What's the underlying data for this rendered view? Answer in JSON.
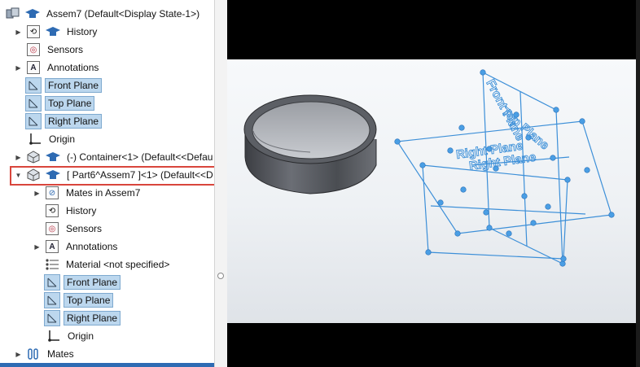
{
  "feature_tree": {
    "root": {
      "label": "Assem7  (Default<Display State-1>)"
    },
    "items": [
      {
        "label": "History",
        "icon": "history-icon"
      },
      {
        "label": "Sensors",
        "icon": "sensor-icon"
      },
      {
        "label": "Annotations",
        "icon": "annotations-icon"
      },
      {
        "label": "Front Plane",
        "icon": "plane-icon",
        "selected": true
      },
      {
        "label": "Top Plane",
        "icon": "plane-icon",
        "selected": true
      },
      {
        "label": "Right Plane",
        "icon": "plane-icon",
        "selected": true
      },
      {
        "label": "Origin",
        "icon": "origin-icon"
      },
      {
        "label": "(-) Container<1> (Default<<Defau",
        "icon": "part-icon"
      },
      {
        "label": "[ Part6^Assem7 ]<1> (Default<<D",
        "icon": "part-icon",
        "highlighted": true
      },
      {
        "label": "Mates in Assem7",
        "icon": "mates-icon"
      },
      {
        "label": "History",
        "icon": "history-icon"
      },
      {
        "label": "Sensors",
        "icon": "sensor-icon"
      },
      {
        "label": "Annotations",
        "icon": "annotations-icon"
      },
      {
        "label": "Material <not specified>",
        "icon": "material-icon"
      },
      {
        "label": "Front Plane",
        "icon": "plane-icon",
        "selected": true
      },
      {
        "label": "Top Plane",
        "icon": "plane-icon",
        "selected": true
      },
      {
        "label": "Right Plane",
        "icon": "plane-icon",
        "selected": true
      },
      {
        "label": "Origin",
        "icon": "origin-icon"
      },
      {
        "label": "Mates",
        "icon": "mates-icon"
      }
    ]
  },
  "viewport": {
    "plane_labels": [
      "Front Plane",
      "Top Plane",
      "Right Plane",
      "Right Plane"
    ]
  },
  "colors": {
    "selection": "#bcd7ee",
    "highlight_border": "#d9463c",
    "plane_lines": "#3c8fd8",
    "handles": "#4a9ee4"
  }
}
